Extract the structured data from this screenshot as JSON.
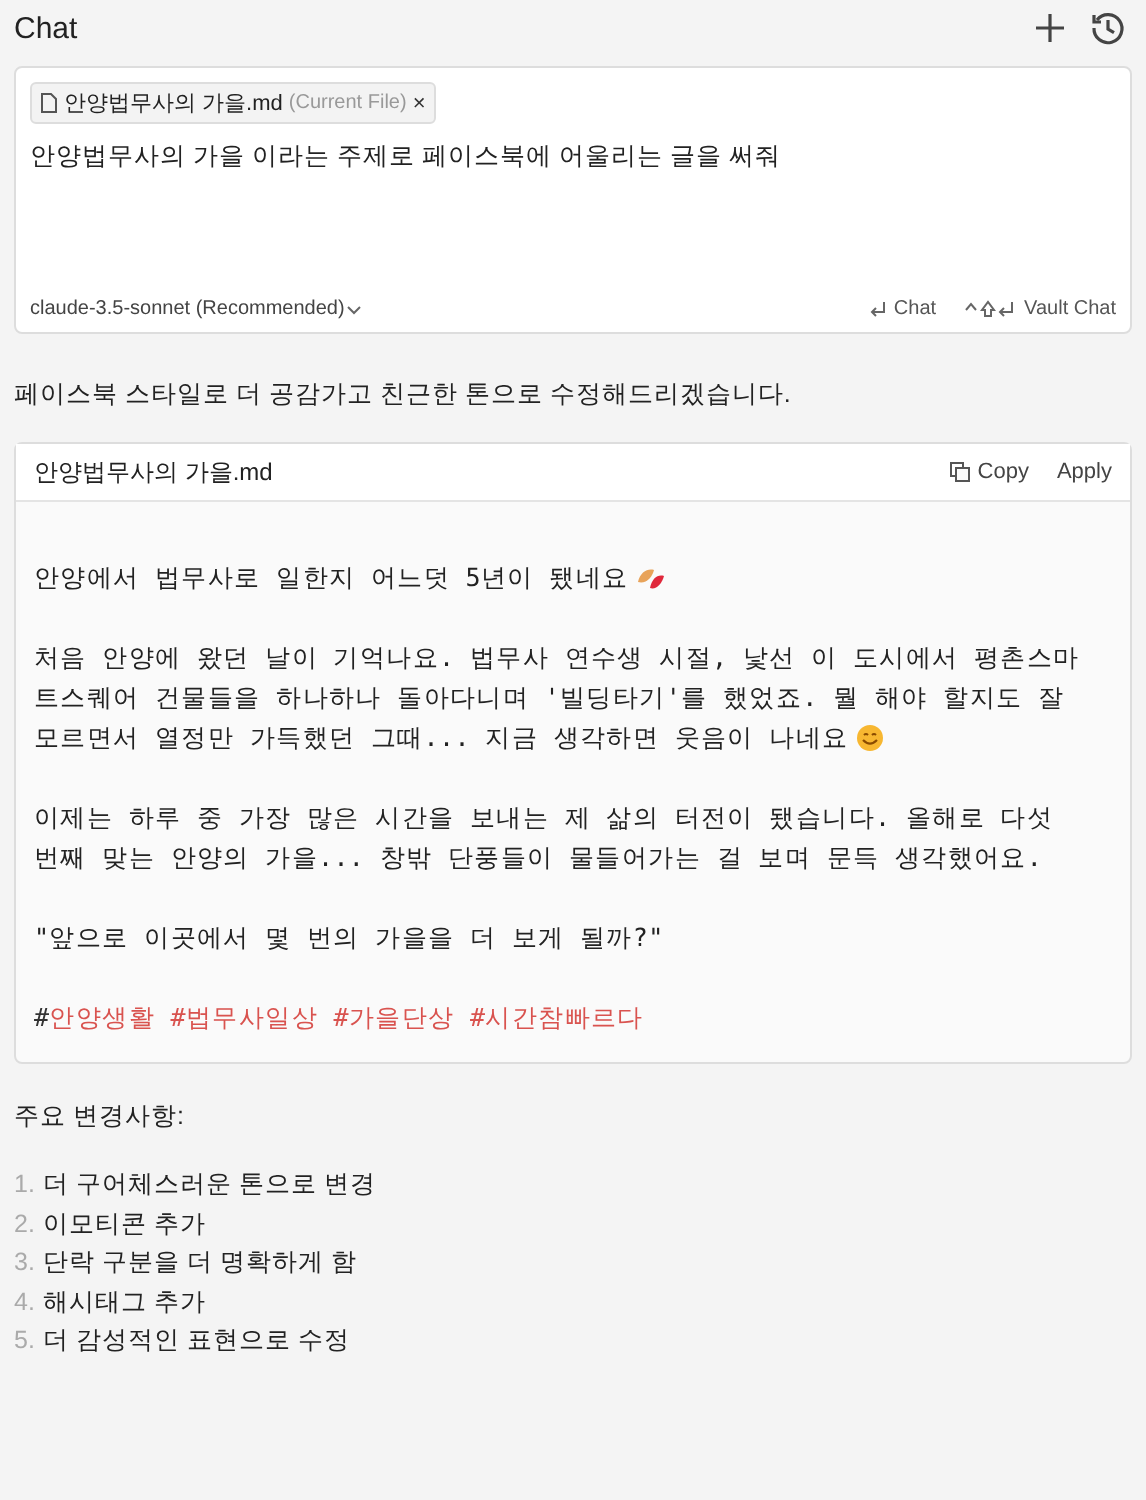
{
  "header": {
    "title": "Chat"
  },
  "input": {
    "chip": {
      "file": "안양법무사의 가을.md",
      "note": "(Current File)",
      "close": "×"
    },
    "value": "안양법무사의 가을 이라는 주제로 페이스북에 어울리는 글을 써줘",
    "model": "claude-3.5-sonnet (Recommended)",
    "actions": [
      {
        "kind": "chat",
        "label": "Chat"
      },
      {
        "kind": "vault",
        "label": "Vault Chat"
      }
    ]
  },
  "reply_intro": "페이스북 스타일로 더 공감가고 친근한 톤으로 수정해드리겠습니다.",
  "code_block": {
    "filename": "안양법무사의 가을.md",
    "copy": "Copy",
    "apply": "Apply",
    "paragraphs": [
      {
        "lines": [
          "안양에서 법무사로 일한지 어느덧 5년이 됐네요"
        ],
        "kind": "leaf"
      },
      {
        "lines": [
          "처음 안양에 왔던 날이 기억나요. 법무사 연수생 시절, 낯선 이 도시에서 평촌스마",
          "트스퀘어 건물들을 하나하나 돌아다니며 '빌딩타기'를 했었죠. 뭘 해야 할지도 잘",
          "모르면서 열정만 가득했던 그때... 지금 생각하면 웃음이 나네요"
        ],
        "kind": "smile"
      },
      {
        "lines": [
          "이제는 하루 중 가장 많은 시간을 보내는 제 삶의 터전이 됐습니다. 올해로 다섯",
          "번째 맞는 안양의 가을... 창밖 단풍들이 물들어가는 걸 보며 문득 생각했어요."
        ]
      },
      {
        "lines": [
          "\"앞으로 이곳에서 몇 번의 가을을 더 보게 될까?\""
        ]
      }
    ],
    "hashtags": {
      "lead": "#",
      "text": "안양생활 #법무사일상 #가을단상 #시간참빠르다"
    }
  },
  "changes_title": "주요 변경사항:",
  "changes": [
    {
      "number": "1.",
      "text": "더 구어체스러운 톤으로 변경"
    },
    {
      "number": "2.",
      "text": "이모티콘 추가"
    },
    {
      "number": "3.",
      "text": "단락 구분을 더 명확하게 함"
    },
    {
      "number": "4.",
      "text": "해시태그 추가"
    },
    {
      "number": "5.",
      "text": "더 감성적인 표현으로 수정"
    }
  ]
}
